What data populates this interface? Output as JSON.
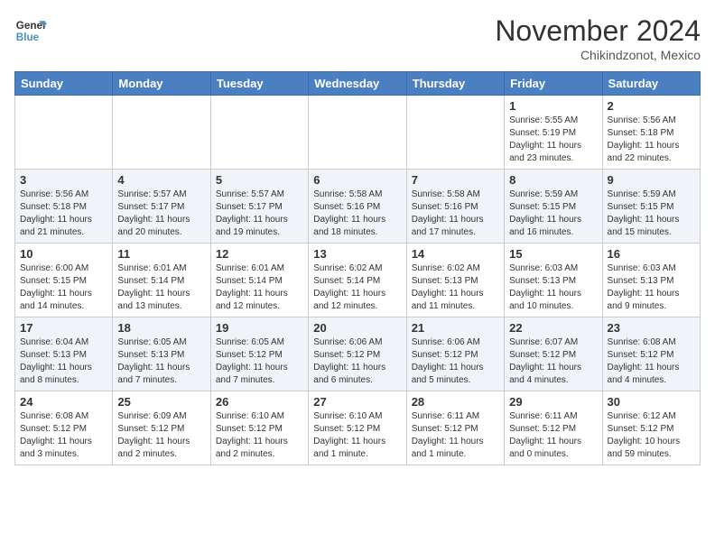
{
  "logo": {
    "line1": "General",
    "line2": "Blue"
  },
  "header": {
    "month": "November 2024",
    "location": "Chikindzonot, Mexico"
  },
  "weekdays": [
    "Sunday",
    "Monday",
    "Tuesday",
    "Wednesday",
    "Thursday",
    "Friday",
    "Saturday"
  ],
  "weeks": [
    [
      {
        "day": "",
        "info": ""
      },
      {
        "day": "",
        "info": ""
      },
      {
        "day": "",
        "info": ""
      },
      {
        "day": "",
        "info": ""
      },
      {
        "day": "",
        "info": ""
      },
      {
        "day": "1",
        "info": "Sunrise: 5:55 AM\nSunset: 5:19 PM\nDaylight: 11 hours and 23 minutes."
      },
      {
        "day": "2",
        "info": "Sunrise: 5:56 AM\nSunset: 5:18 PM\nDaylight: 11 hours and 22 minutes."
      }
    ],
    [
      {
        "day": "3",
        "info": "Sunrise: 5:56 AM\nSunset: 5:18 PM\nDaylight: 11 hours and 21 minutes."
      },
      {
        "day": "4",
        "info": "Sunrise: 5:57 AM\nSunset: 5:17 PM\nDaylight: 11 hours and 20 minutes."
      },
      {
        "day": "5",
        "info": "Sunrise: 5:57 AM\nSunset: 5:17 PM\nDaylight: 11 hours and 19 minutes."
      },
      {
        "day": "6",
        "info": "Sunrise: 5:58 AM\nSunset: 5:16 PM\nDaylight: 11 hours and 18 minutes."
      },
      {
        "day": "7",
        "info": "Sunrise: 5:58 AM\nSunset: 5:16 PM\nDaylight: 11 hours and 17 minutes."
      },
      {
        "day": "8",
        "info": "Sunrise: 5:59 AM\nSunset: 5:15 PM\nDaylight: 11 hours and 16 minutes."
      },
      {
        "day": "9",
        "info": "Sunrise: 5:59 AM\nSunset: 5:15 PM\nDaylight: 11 hours and 15 minutes."
      }
    ],
    [
      {
        "day": "10",
        "info": "Sunrise: 6:00 AM\nSunset: 5:15 PM\nDaylight: 11 hours and 14 minutes."
      },
      {
        "day": "11",
        "info": "Sunrise: 6:01 AM\nSunset: 5:14 PM\nDaylight: 11 hours and 13 minutes."
      },
      {
        "day": "12",
        "info": "Sunrise: 6:01 AM\nSunset: 5:14 PM\nDaylight: 11 hours and 12 minutes."
      },
      {
        "day": "13",
        "info": "Sunrise: 6:02 AM\nSunset: 5:14 PM\nDaylight: 11 hours and 12 minutes."
      },
      {
        "day": "14",
        "info": "Sunrise: 6:02 AM\nSunset: 5:13 PM\nDaylight: 11 hours and 11 minutes."
      },
      {
        "day": "15",
        "info": "Sunrise: 6:03 AM\nSunset: 5:13 PM\nDaylight: 11 hours and 10 minutes."
      },
      {
        "day": "16",
        "info": "Sunrise: 6:03 AM\nSunset: 5:13 PM\nDaylight: 11 hours and 9 minutes."
      }
    ],
    [
      {
        "day": "17",
        "info": "Sunrise: 6:04 AM\nSunset: 5:13 PM\nDaylight: 11 hours and 8 minutes."
      },
      {
        "day": "18",
        "info": "Sunrise: 6:05 AM\nSunset: 5:13 PM\nDaylight: 11 hours and 7 minutes."
      },
      {
        "day": "19",
        "info": "Sunrise: 6:05 AM\nSunset: 5:12 PM\nDaylight: 11 hours and 7 minutes."
      },
      {
        "day": "20",
        "info": "Sunrise: 6:06 AM\nSunset: 5:12 PM\nDaylight: 11 hours and 6 minutes."
      },
      {
        "day": "21",
        "info": "Sunrise: 6:06 AM\nSunset: 5:12 PM\nDaylight: 11 hours and 5 minutes."
      },
      {
        "day": "22",
        "info": "Sunrise: 6:07 AM\nSunset: 5:12 PM\nDaylight: 11 hours and 4 minutes."
      },
      {
        "day": "23",
        "info": "Sunrise: 6:08 AM\nSunset: 5:12 PM\nDaylight: 11 hours and 4 minutes."
      }
    ],
    [
      {
        "day": "24",
        "info": "Sunrise: 6:08 AM\nSunset: 5:12 PM\nDaylight: 11 hours and 3 minutes."
      },
      {
        "day": "25",
        "info": "Sunrise: 6:09 AM\nSunset: 5:12 PM\nDaylight: 11 hours and 2 minutes."
      },
      {
        "day": "26",
        "info": "Sunrise: 6:10 AM\nSunset: 5:12 PM\nDaylight: 11 hours and 2 minutes."
      },
      {
        "day": "27",
        "info": "Sunrise: 6:10 AM\nSunset: 5:12 PM\nDaylight: 11 hours and 1 minute."
      },
      {
        "day": "28",
        "info": "Sunrise: 6:11 AM\nSunset: 5:12 PM\nDaylight: 11 hours and 1 minute."
      },
      {
        "day": "29",
        "info": "Sunrise: 6:11 AM\nSunset: 5:12 PM\nDaylight: 11 hours and 0 minutes."
      },
      {
        "day": "30",
        "info": "Sunrise: 6:12 AM\nSunset: 5:12 PM\nDaylight: 10 hours and 59 minutes."
      }
    ]
  ]
}
